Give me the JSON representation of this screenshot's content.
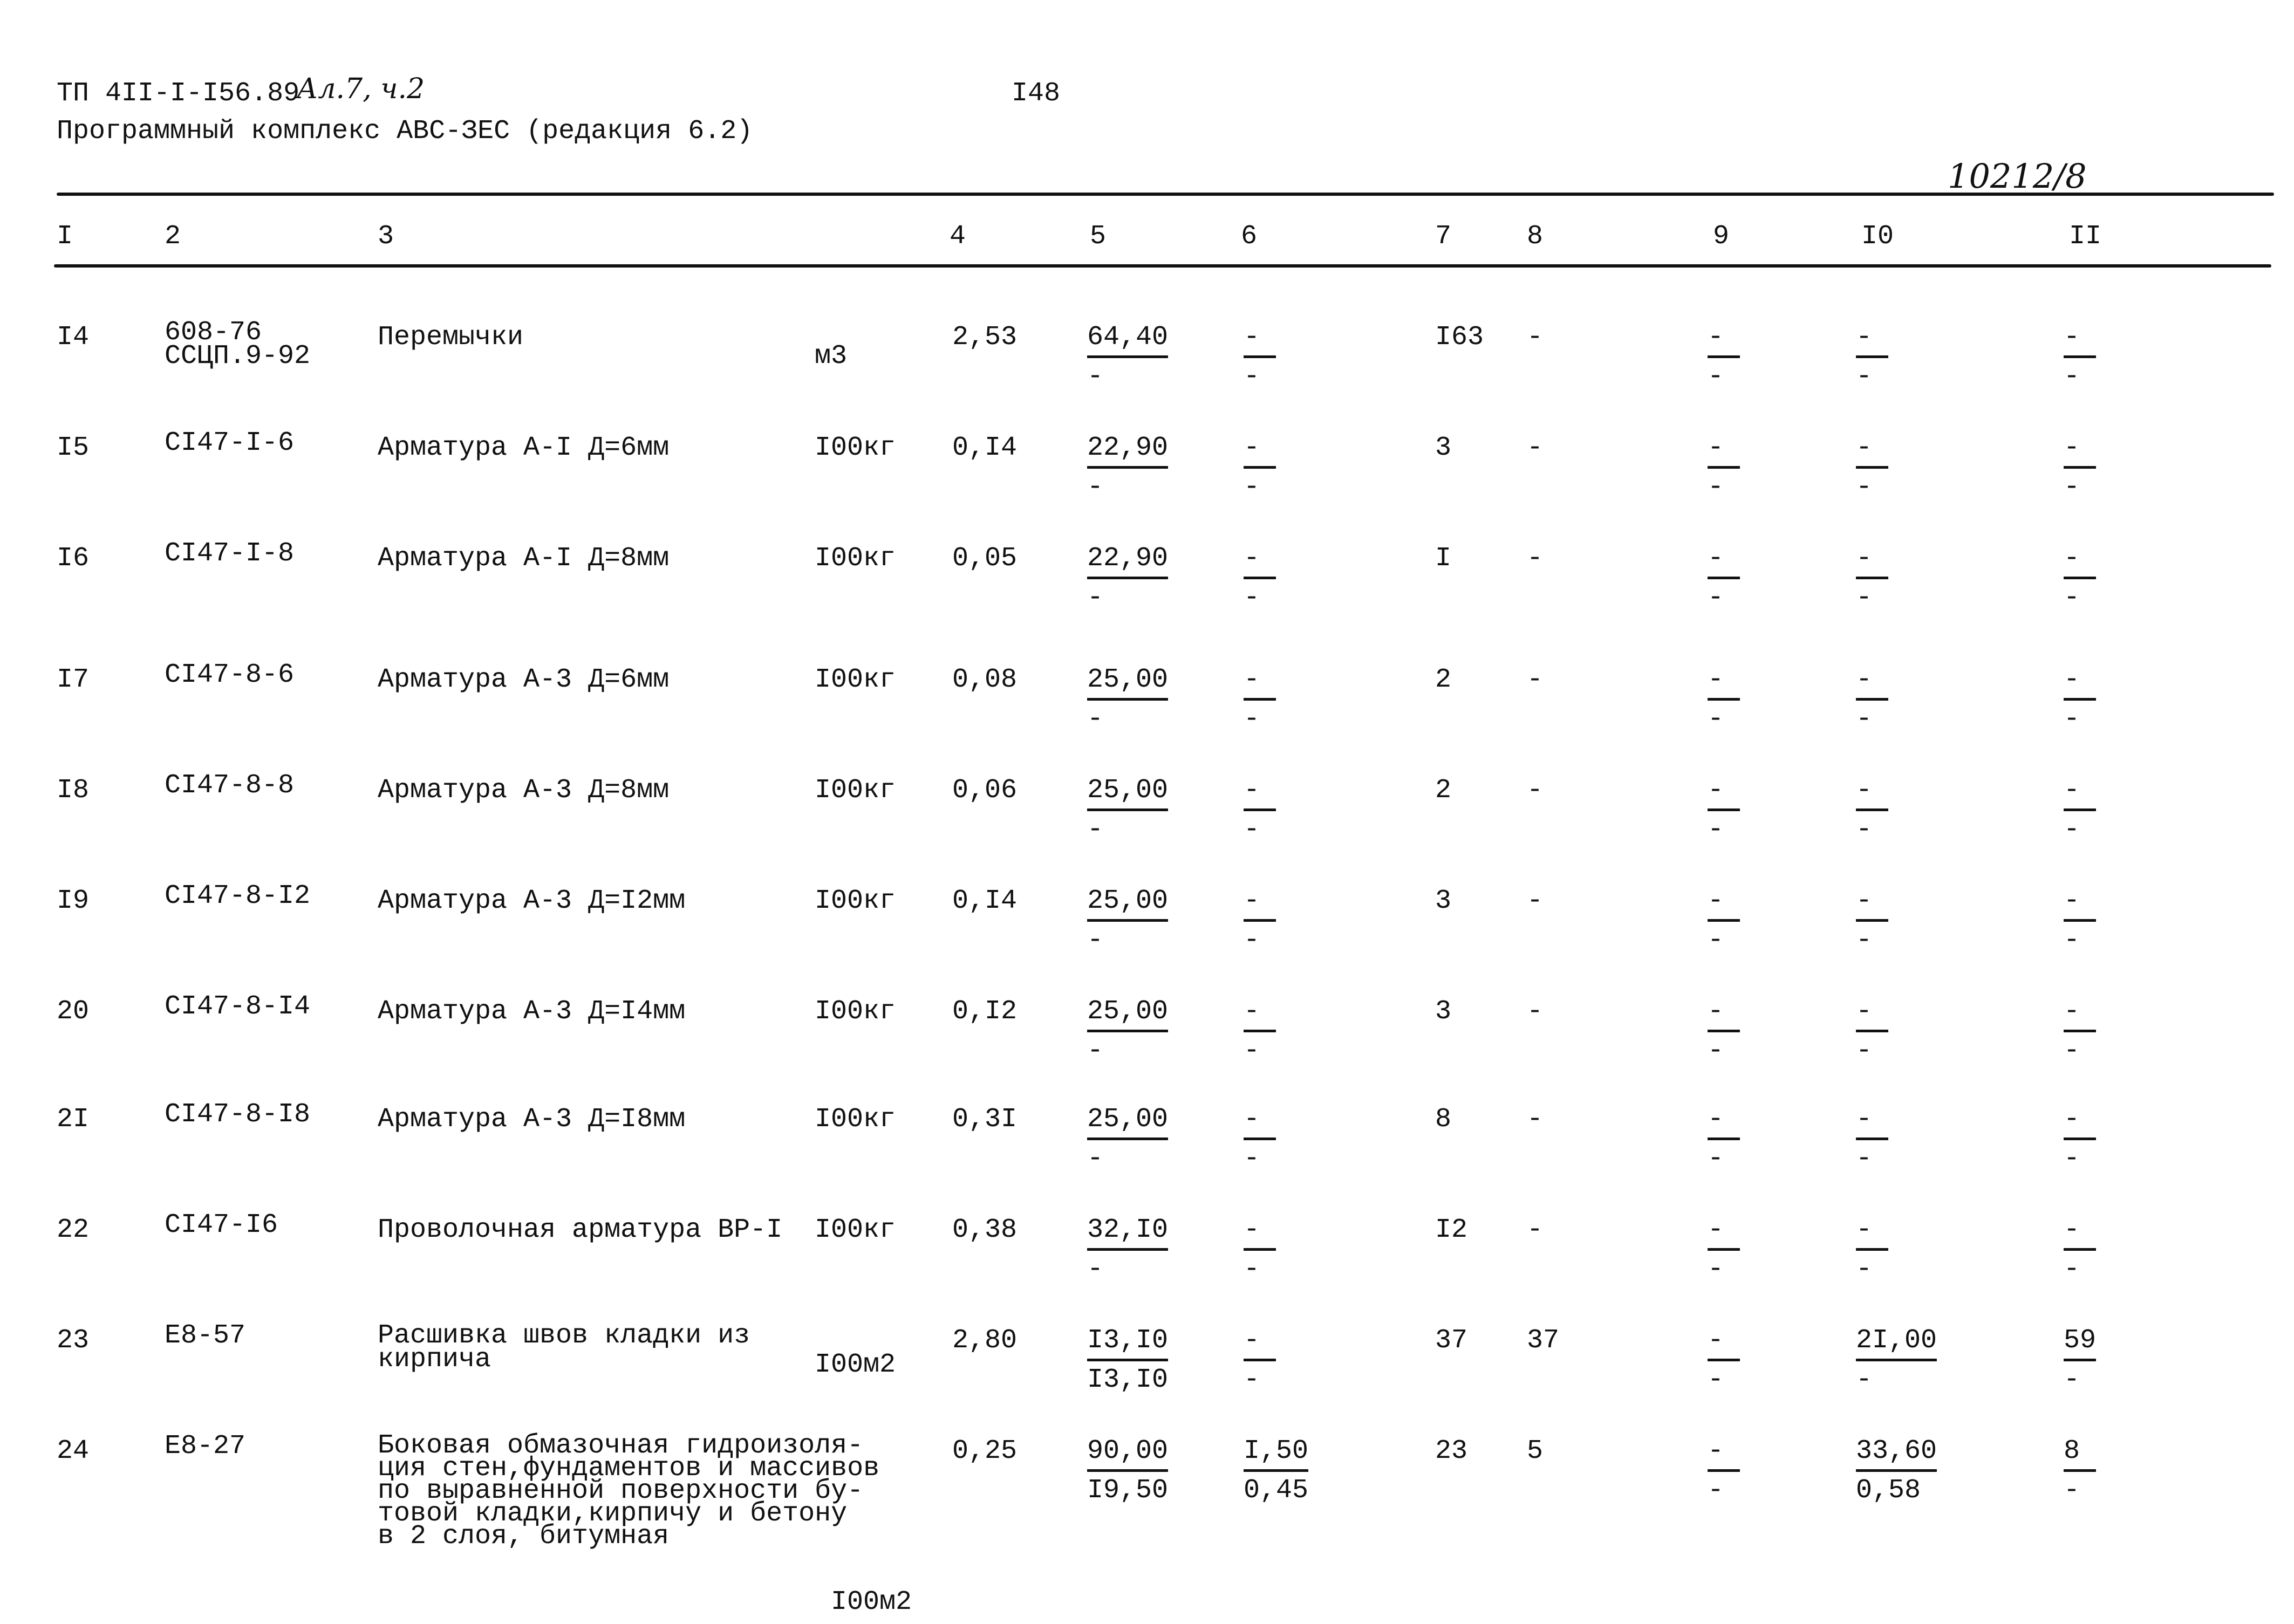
{
  "header": {
    "doc_code": "ТП 4II-I-I56.89",
    "handwritten_note": "Ал.7, ч.2",
    "page_number": "I48",
    "subtitle": "Программный комплекс АВС-ЗЕС (редакция 6.2)",
    "handwritten_ref": "10212/8"
  },
  "columns": [
    "I",
    "2",
    "3",
    "4",
    "5",
    "6",
    "7",
    "8",
    "9",
    "I0",
    "II"
  ],
  "rows": [
    {
      "n": "I4",
      "code": "608-76\nССЦП.9-92",
      "name": "Перемычки",
      "unit": "м3",
      "qty": "2,53",
      "c5": [
        "64,40",
        "-"
      ],
      "c6": [
        "-",
        "-"
      ],
      "c7": "I63",
      "c8": "-",
      "c9": [
        "-",
        "-"
      ],
      "c10": [
        "-",
        "-"
      ],
      "c11": [
        "-",
        "-"
      ]
    },
    {
      "n": "I5",
      "code": "CI47-I-6",
      "name": "Арматура А-I Д=6мм",
      "unit": "I00кг",
      "qty": "0,I4",
      "c5": [
        "22,90",
        "-"
      ],
      "c6": [
        "-",
        "-"
      ],
      "c7": "3",
      "c8": "-",
      "c9": [
        "-",
        "-"
      ],
      "c10": [
        "-",
        "-"
      ],
      "c11": [
        "-",
        "-"
      ]
    },
    {
      "n": "I6",
      "code": "CI47-I-8",
      "name": "Арматура А-I Д=8мм",
      "unit": "I00кг",
      "qty": "0,05",
      "c5": [
        "22,90",
        "-"
      ],
      "c6": [
        "-",
        "-"
      ],
      "c7": "I",
      "c8": "-",
      "c9": [
        "-",
        "-"
      ],
      "c10": [
        "-",
        "-"
      ],
      "c11": [
        "-",
        "-"
      ]
    },
    {
      "n": "I7",
      "code": "CI47-8-6",
      "name": "Арматура А-3 Д=6мм",
      "unit": "I00кг",
      "qty": "0,08",
      "c5": [
        "25,00",
        "-"
      ],
      "c6": [
        "-",
        "-"
      ],
      "c7": "2",
      "c8": "-",
      "c9": [
        "-",
        "-"
      ],
      "c10": [
        "-",
        "-"
      ],
      "c11": [
        "-",
        "-"
      ]
    },
    {
      "n": "I8",
      "code": "CI47-8-8",
      "name": "Арматура А-3 Д=8мм",
      "unit": "I00кг",
      "qty": "0,06",
      "c5": [
        "25,00",
        "-"
      ],
      "c6": [
        "-",
        "-"
      ],
      "c7": "2",
      "c8": "-",
      "c9": [
        "-",
        "-"
      ],
      "c10": [
        "-",
        "-"
      ],
      "c11": [
        "-",
        "-"
      ]
    },
    {
      "n": "I9",
      "code": "CI47-8-I2",
      "name": "Арматура А-3 Д=I2мм",
      "unit": "I00кг",
      "qty": "0,I4",
      "c5": [
        "25,00",
        "-"
      ],
      "c6": [
        "-",
        "-"
      ],
      "c7": "3",
      "c8": "-",
      "c9": [
        "-",
        "-"
      ],
      "c10": [
        "-",
        "-"
      ],
      "c11": [
        "-",
        "-"
      ]
    },
    {
      "n": "20",
      "code": "CI47-8-I4",
      "name": "Арматура А-3 Д=I4мм",
      "unit": "I00кг",
      "qty": "0,I2",
      "c5": [
        "25,00",
        "-"
      ],
      "c6": [
        "-",
        "-"
      ],
      "c7": "3",
      "c8": "-",
      "c9": [
        "-",
        "-"
      ],
      "c10": [
        "-",
        "-"
      ],
      "c11": [
        "-",
        "-"
      ]
    },
    {
      "n": "2I",
      "code": "CI47-8-I8",
      "name": "Арматура А-3 Д=I8мм",
      "unit": "I00кг",
      "qty": "0,3I",
      "c5": [
        "25,00",
        "-"
      ],
      "c6": [
        "-",
        "-"
      ],
      "c7": "8",
      "c8": "-",
      "c9": [
        "-",
        "-"
      ],
      "c10": [
        "-",
        "-"
      ],
      "c11": [
        "-",
        "-"
      ]
    },
    {
      "n": "22",
      "code": "CI47-I6",
      "name": "Проволочная арматура ВР-I",
      "unit": "I00кг",
      "qty": "0,38",
      "c5": [
        "32,I0",
        "-"
      ],
      "c6": [
        "-",
        "-"
      ],
      "c7": "I2",
      "c8": "-",
      "c9": [
        "-",
        "-"
      ],
      "c10": [
        "-",
        "-"
      ],
      "c11": [
        "-",
        "-"
      ]
    },
    {
      "n": "23",
      "code": "Е8-57",
      "name": "Расшивка швов кладки из\nкирпича",
      "unit": "I00м2",
      "qty": "2,80",
      "c5": [
        "I3,I0",
        "I3,I0"
      ],
      "c6": [
        "-",
        "-"
      ],
      "c7": "37",
      "c8": "37",
      "c9": [
        "-",
        "-"
      ],
      "c10": [
        "2I,00",
        "-"
      ],
      "c11": [
        "59",
        "-"
      ]
    },
    {
      "n": "24",
      "code": "Е8-27",
      "name": "Боковая обмазочная гидроизоля-\nция стен,фундаментов и массивов\nпо выравненной поверхности бу-\nтовой кладки,кирпичу и бетону\nв 2 слоя, битумная",
      "unit": "I00м2",
      "qty": "0,25",
      "c5": [
        "90,00",
        "I9,50"
      ],
      "c6": [
        "I,50",
        "0,45"
      ],
      "c7": "23",
      "c8": "5",
      "c9": [
        "-",
        "-"
      ],
      "c10": [
        "33,60",
        "0,58"
      ],
      "c11": [
        "8",
        "-"
      ]
    }
  ]
}
